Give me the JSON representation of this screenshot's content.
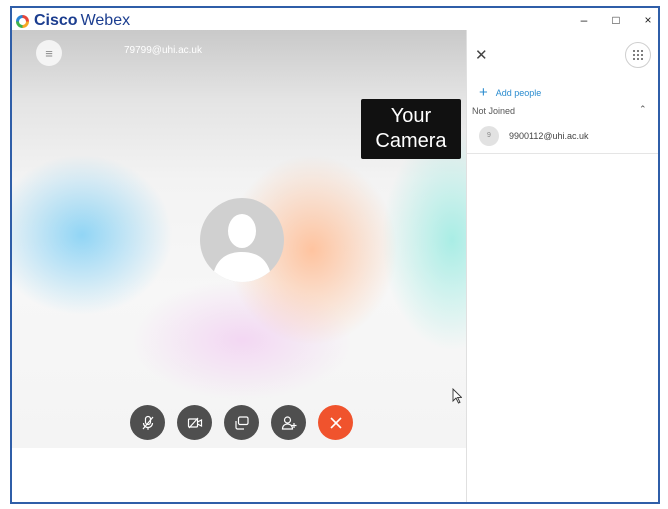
{
  "app": {
    "brand": "Cisco",
    "product": "Webex"
  },
  "window_controls": {
    "minimize": "–",
    "maximize": "□",
    "close": "×"
  },
  "meeting": {
    "id": "79799@uhi.ac.uk"
  },
  "camera_label": {
    "line1": "Your",
    "line2": "Camera"
  },
  "controls": [
    {
      "name": "mute",
      "icon": "microphone-muted-icon"
    },
    {
      "name": "video",
      "icon": "video-off-icon"
    },
    {
      "name": "share",
      "icon": "share-screen-icon"
    },
    {
      "name": "participants",
      "icon": "add-participant-icon"
    },
    {
      "name": "end",
      "icon": "close-icon",
      "color": "#f0532d"
    }
  ],
  "panel": {
    "add_people_label": "Add people",
    "section_label": "Not Joined",
    "participants": [
      {
        "initial": "9",
        "email": "9900112@uhi.ac.uk"
      }
    ]
  },
  "colors": {
    "accent": "#2b8ccf",
    "end_call": "#f0532d",
    "frame_border": "#2f5ea8"
  }
}
